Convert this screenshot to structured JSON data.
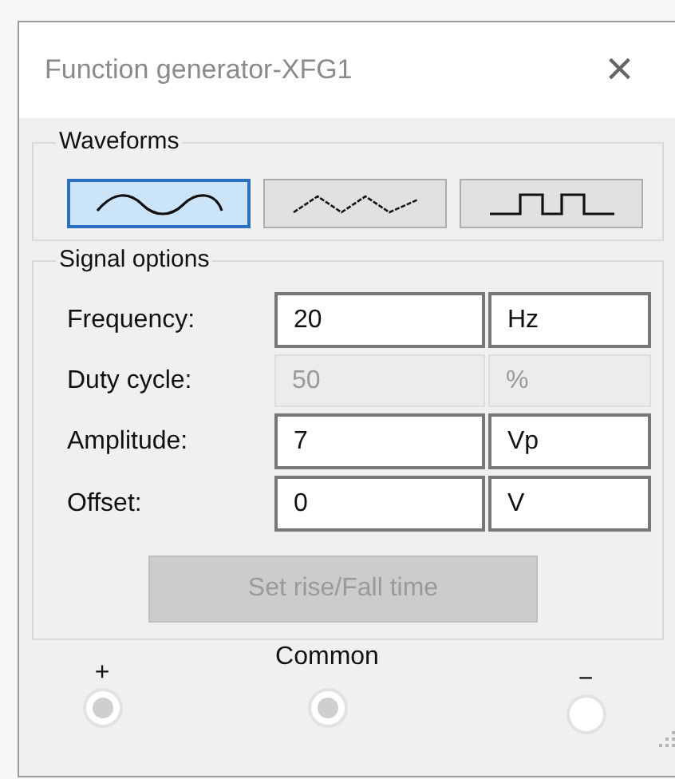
{
  "window": {
    "title": "Function generator-XFG1",
    "close": "×"
  },
  "waveforms": {
    "title": "Waveforms",
    "items": [
      {
        "kind": "sine",
        "selected": true
      },
      {
        "kind": "triangle",
        "selected": false
      },
      {
        "kind": "square",
        "selected": false
      }
    ]
  },
  "signal_options": {
    "title": "Signal options",
    "rows": [
      {
        "label": "Frequency:",
        "value": "20",
        "unit": "Hz",
        "disabled": false
      },
      {
        "label": "Duty cycle:",
        "value": "50",
        "unit": "%",
        "disabled": true
      },
      {
        "label": "Amplitude:",
        "value": "7",
        "unit": "Vp",
        "disabled": false
      },
      {
        "label": "Offset:",
        "value": "0",
        "unit": "V",
        "disabled": false
      }
    ],
    "button": {
      "label": "Set rise/Fall time",
      "disabled": true
    }
  },
  "terminals": [
    {
      "label": "+",
      "filled": true
    },
    {
      "label": "Common",
      "filled": true
    },
    {
      "label": "−",
      "filled": false
    }
  ]
}
